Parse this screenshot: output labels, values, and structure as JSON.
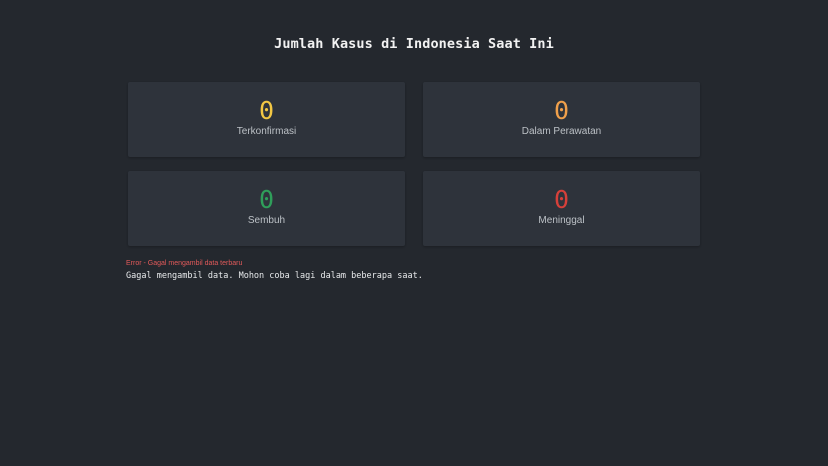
{
  "header": {
    "title": "Jumlah Kasus di Indonesia Saat Ini"
  },
  "stats": {
    "confirmed": {
      "value": "0",
      "label": "Terkonfirmasi",
      "color": "#f2c744"
    },
    "treated": {
      "value": "0",
      "label": "Dalam Perawatan",
      "color": "#f0a04b"
    },
    "recovered": {
      "value": "0",
      "label": "Sembuh",
      "color": "#2f9e5a"
    },
    "deaths": {
      "value": "0",
      "label": "Meninggal",
      "color": "#d6403a"
    }
  },
  "error": {
    "title": "Error - Gagal mengambil data terbaru",
    "message": "Gagal mengambil data. Mohon coba lagi dalam beberapa saat."
  }
}
